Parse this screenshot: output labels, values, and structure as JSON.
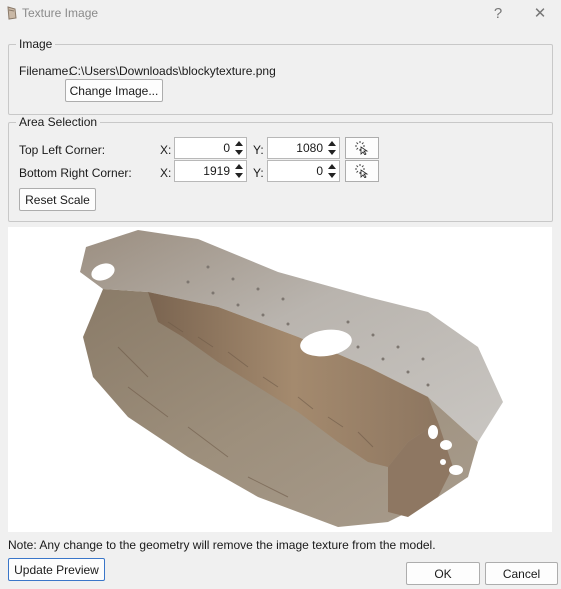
{
  "window": {
    "title": "Texture Image",
    "help_label": "?",
    "close_label": "✕"
  },
  "image_group": {
    "legend": "Image",
    "filename_label": "Filename:",
    "filename_value": "C:\\Users\\Downloads\\blockytexture.png",
    "change_button": "Change Image..."
  },
  "area_group": {
    "legend": "Area Selection",
    "rows": [
      {
        "label": "Top Left Corner:",
        "x_label": "X:",
        "x_value": "0",
        "y_label": "Y:",
        "y_value": "1080"
      },
      {
        "label": "Bottom Right Corner:",
        "x_label": "X:",
        "x_value": "1919",
        "y_label": "Y:",
        "y_value": "0"
      }
    ],
    "pick_icon": "pointer-pick-icon",
    "reset_button": "Reset Scale"
  },
  "preview": {
    "description_icon": "texture-preview-image"
  },
  "note": "Note: Any change to the geometry will remove the image texture from the model.",
  "buttons": {
    "update_preview": "Update Preview",
    "ok": "OK",
    "cancel": "Cancel"
  },
  "colors": {
    "background": "#f0f0f0",
    "focus_border": "#3a76c9"
  }
}
